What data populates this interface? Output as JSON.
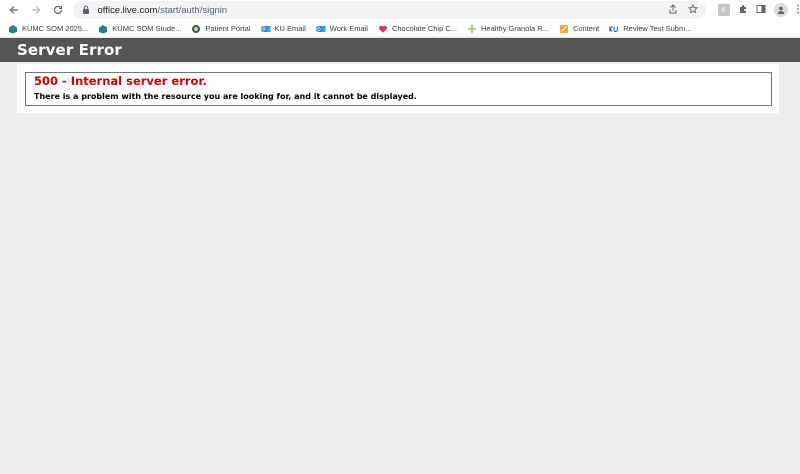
{
  "browser": {
    "url_host": "office.live.com",
    "url_path": "/start/auth/signin",
    "extension_badge": "K",
    "bookmarks": [
      {
        "label": "KUMC SOM 2025...",
        "icon": "kumc-logo-icon"
      },
      {
        "label": "KUMC SOM Stude...",
        "icon": "kumc-logo-icon"
      },
      {
        "label": "Patient Portal",
        "icon": "portal-icon"
      },
      {
        "label": "KU Email",
        "icon": "outlook-icon"
      },
      {
        "label": "Work Email",
        "icon": "outlook-icon"
      },
      {
        "label": "Chocolate Chip C...",
        "icon": "heart-icon"
      },
      {
        "label": "Healthy Granola R...",
        "icon": "plus-icon"
      },
      {
        "label": "Content",
        "icon": "content-icon"
      },
      {
        "label": "Review Test Subm...",
        "icon": "ku-icon"
      }
    ]
  },
  "page": {
    "header_title": "Server Error",
    "error_heading": "500 - Internal server error.",
    "error_message": "There is a problem with the resource you are looking for, and it cannot be displayed."
  },
  "colors": {
    "header_bg": "#555555",
    "error_red": "#cc0000",
    "page_bg": "#eeeeee"
  }
}
